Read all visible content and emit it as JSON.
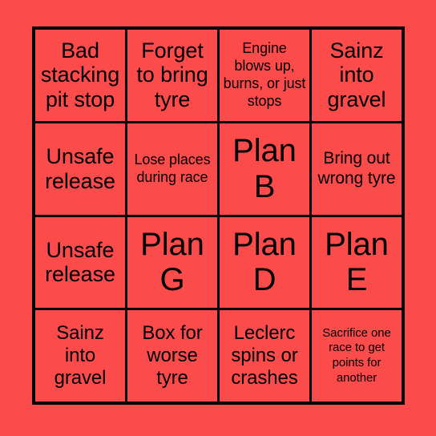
{
  "card": {
    "background_color": "#fb4b4b",
    "border_color": "#000000",
    "text_color": "#000000",
    "rows": 4,
    "columns": 4,
    "cells": [
      {
        "text": "Bad stacking pit stop",
        "size": "fs-xl"
      },
      {
        "text": "Forget to bring tyre",
        "size": "fs-xl"
      },
      {
        "text": "Engine blows up, burns, or just stops",
        "size": "fs-sm"
      },
      {
        "text": "Sainz into gravel",
        "size": "fs-xl"
      },
      {
        "text": "Unsafe release",
        "size": "fs-xl"
      },
      {
        "text": "Lose places during race",
        "size": "fs-sm"
      },
      {
        "text": "Plan B",
        "size": "fs-xxl"
      },
      {
        "text": "Bring out wrong tyre",
        "size": "fs-md"
      },
      {
        "text": "Unsafe release",
        "size": "fs-xl"
      },
      {
        "text": "Plan G",
        "size": "fs-xxl"
      },
      {
        "text": "Plan D",
        "size": "fs-xxl"
      },
      {
        "text": "Plan E",
        "size": "fs-xxl"
      },
      {
        "text": "Sainz into gravel",
        "size": "fs-lg"
      },
      {
        "text": "Box for worse tyre",
        "size": "fs-lg"
      },
      {
        "text": "Leclerc spins or crashes",
        "size": "fs-lg"
      },
      {
        "text": "Sacrifice one race to get points for another",
        "size": "fs-xs"
      }
    ]
  }
}
